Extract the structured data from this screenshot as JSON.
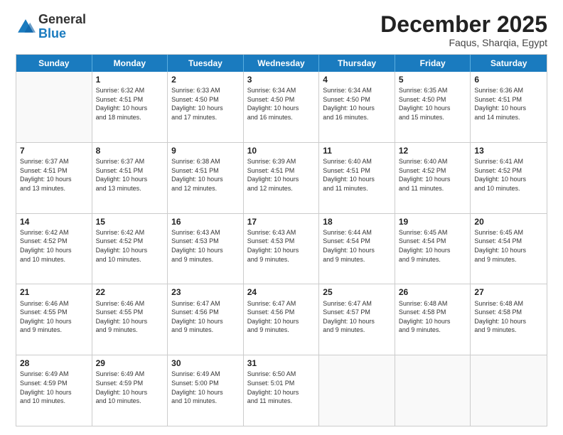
{
  "header": {
    "logo_general": "General",
    "logo_blue": "Blue",
    "month_title": "December 2025",
    "location": "Faqus, Sharqia, Egypt"
  },
  "days_of_week": [
    "Sunday",
    "Monday",
    "Tuesday",
    "Wednesday",
    "Thursday",
    "Friday",
    "Saturday"
  ],
  "weeks": [
    [
      {
        "day": "",
        "info": ""
      },
      {
        "day": "1",
        "info": "Sunrise: 6:32 AM\nSunset: 4:51 PM\nDaylight: 10 hours\nand 18 minutes."
      },
      {
        "day": "2",
        "info": "Sunrise: 6:33 AM\nSunset: 4:50 PM\nDaylight: 10 hours\nand 17 minutes."
      },
      {
        "day": "3",
        "info": "Sunrise: 6:34 AM\nSunset: 4:50 PM\nDaylight: 10 hours\nand 16 minutes."
      },
      {
        "day": "4",
        "info": "Sunrise: 6:34 AM\nSunset: 4:50 PM\nDaylight: 10 hours\nand 16 minutes."
      },
      {
        "day": "5",
        "info": "Sunrise: 6:35 AM\nSunset: 4:50 PM\nDaylight: 10 hours\nand 15 minutes."
      },
      {
        "day": "6",
        "info": "Sunrise: 6:36 AM\nSunset: 4:51 PM\nDaylight: 10 hours\nand 14 minutes."
      }
    ],
    [
      {
        "day": "7",
        "info": "Sunrise: 6:37 AM\nSunset: 4:51 PM\nDaylight: 10 hours\nand 13 minutes."
      },
      {
        "day": "8",
        "info": "Sunrise: 6:37 AM\nSunset: 4:51 PM\nDaylight: 10 hours\nand 13 minutes."
      },
      {
        "day": "9",
        "info": "Sunrise: 6:38 AM\nSunset: 4:51 PM\nDaylight: 10 hours\nand 12 minutes."
      },
      {
        "day": "10",
        "info": "Sunrise: 6:39 AM\nSunset: 4:51 PM\nDaylight: 10 hours\nand 12 minutes."
      },
      {
        "day": "11",
        "info": "Sunrise: 6:40 AM\nSunset: 4:51 PM\nDaylight: 10 hours\nand 11 minutes."
      },
      {
        "day": "12",
        "info": "Sunrise: 6:40 AM\nSunset: 4:52 PM\nDaylight: 10 hours\nand 11 minutes."
      },
      {
        "day": "13",
        "info": "Sunrise: 6:41 AM\nSunset: 4:52 PM\nDaylight: 10 hours\nand 10 minutes."
      }
    ],
    [
      {
        "day": "14",
        "info": "Sunrise: 6:42 AM\nSunset: 4:52 PM\nDaylight: 10 hours\nand 10 minutes."
      },
      {
        "day": "15",
        "info": "Sunrise: 6:42 AM\nSunset: 4:52 PM\nDaylight: 10 hours\nand 10 minutes."
      },
      {
        "day": "16",
        "info": "Sunrise: 6:43 AM\nSunset: 4:53 PM\nDaylight: 10 hours\nand 9 minutes."
      },
      {
        "day": "17",
        "info": "Sunrise: 6:43 AM\nSunset: 4:53 PM\nDaylight: 10 hours\nand 9 minutes."
      },
      {
        "day": "18",
        "info": "Sunrise: 6:44 AM\nSunset: 4:54 PM\nDaylight: 10 hours\nand 9 minutes."
      },
      {
        "day": "19",
        "info": "Sunrise: 6:45 AM\nSunset: 4:54 PM\nDaylight: 10 hours\nand 9 minutes."
      },
      {
        "day": "20",
        "info": "Sunrise: 6:45 AM\nSunset: 4:54 PM\nDaylight: 10 hours\nand 9 minutes."
      }
    ],
    [
      {
        "day": "21",
        "info": "Sunrise: 6:46 AM\nSunset: 4:55 PM\nDaylight: 10 hours\nand 9 minutes."
      },
      {
        "day": "22",
        "info": "Sunrise: 6:46 AM\nSunset: 4:55 PM\nDaylight: 10 hours\nand 9 minutes."
      },
      {
        "day": "23",
        "info": "Sunrise: 6:47 AM\nSunset: 4:56 PM\nDaylight: 10 hours\nand 9 minutes."
      },
      {
        "day": "24",
        "info": "Sunrise: 6:47 AM\nSunset: 4:56 PM\nDaylight: 10 hours\nand 9 minutes."
      },
      {
        "day": "25",
        "info": "Sunrise: 6:47 AM\nSunset: 4:57 PM\nDaylight: 10 hours\nand 9 minutes."
      },
      {
        "day": "26",
        "info": "Sunrise: 6:48 AM\nSunset: 4:58 PM\nDaylight: 10 hours\nand 9 minutes."
      },
      {
        "day": "27",
        "info": "Sunrise: 6:48 AM\nSunset: 4:58 PM\nDaylight: 10 hours\nand 9 minutes."
      }
    ],
    [
      {
        "day": "28",
        "info": "Sunrise: 6:49 AM\nSunset: 4:59 PM\nDaylight: 10 hours\nand 10 minutes."
      },
      {
        "day": "29",
        "info": "Sunrise: 6:49 AM\nSunset: 4:59 PM\nDaylight: 10 hours\nand 10 minutes."
      },
      {
        "day": "30",
        "info": "Sunrise: 6:49 AM\nSunset: 5:00 PM\nDaylight: 10 hours\nand 10 minutes."
      },
      {
        "day": "31",
        "info": "Sunrise: 6:50 AM\nSunset: 5:01 PM\nDaylight: 10 hours\nand 11 minutes."
      },
      {
        "day": "",
        "info": ""
      },
      {
        "day": "",
        "info": ""
      },
      {
        "day": "",
        "info": ""
      }
    ]
  ]
}
